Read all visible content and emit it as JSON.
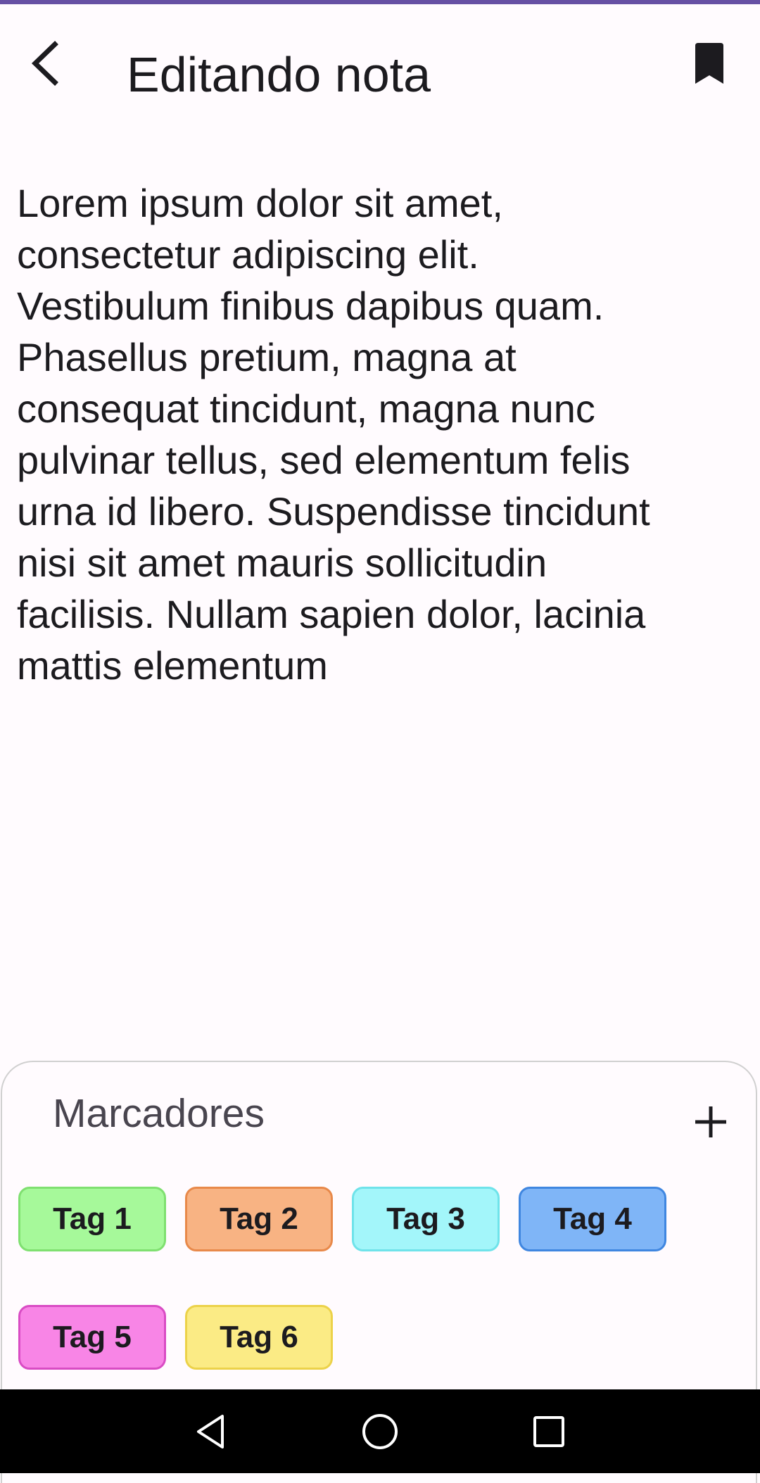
{
  "app_bar": {
    "title": "Editando nota",
    "back_icon": "arrow-back-icon",
    "bookmark_icon": "bookmark-icon"
  },
  "note": {
    "text": "Lorem ipsum dolor sit amet,\nconsectetur adipiscing elit.\nVestibulum finibus dapibus quam.\nPhasellus pretium, magna at\nconsequat tincidunt, magna nunc\npulvinar tellus, sed elementum felis\nurna id libero. Suspendisse tincidunt\nnisi sit amet mauris sollicitudin\nfacilisis. Nullam sapien dolor, lacinia\nmattis elementum"
  },
  "tags_panel": {
    "title": "Marcadores",
    "add_icon": "plus-icon",
    "tags": [
      {
        "label": "Tag 1",
        "fill": "#a6f99a",
        "border": "#7fe070"
      },
      {
        "label": "Tag 2",
        "fill": "#f8b383",
        "border": "#e8894a"
      },
      {
        "label": "Tag 3",
        "fill": "#a3f6fa",
        "border": "#6fe3ea"
      },
      {
        "label": "Tag 4",
        "fill": "#7fb5f7",
        "border": "#3f86e0"
      },
      {
        "label": "Tag 5",
        "fill": "#f885e6",
        "border": "#d94cc4"
      },
      {
        "label": "Tag 6",
        "fill": "#fbeb85",
        "border": "#ecd24a"
      }
    ]
  },
  "colors": {
    "accent": "#6750a4",
    "background": "#fffbfe",
    "text": "#1c1b1f"
  },
  "navigation": {
    "back_icon": "triangle-back-icon",
    "home_icon": "circle-home-icon",
    "recents_icon": "square-recents-icon"
  }
}
